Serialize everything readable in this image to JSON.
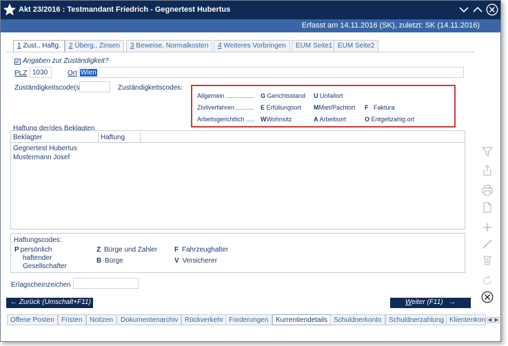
{
  "window": {
    "title": "Akt 23/2016 : Testmandant Friedrich - Gegnertest Hubertus",
    "info": "Erfasst am 14.11.2016 (SK), zuletzt: SK (14.11.2016)"
  },
  "tabs": [
    {
      "num": "1",
      "label": " Zust., Haftg."
    },
    {
      "num": "2",
      "label": " Überg., Zinsen"
    },
    {
      "num": "3",
      "label": " Beweise, Normalkosten"
    },
    {
      "num": "4",
      "label": " Weiteres Vorbringen"
    },
    {
      "num": "",
      "label": "EUM Seite1"
    },
    {
      "num": "",
      "label": "EUM Seite2"
    }
  ],
  "zustaendigkeit": {
    "checkbox_label": "Angaben zur Zuständigkeit?",
    "checked": true,
    "plz_label": "PLZ",
    "plz_value": "1030",
    "ort_label": "Ort",
    "ort_value": "Wien",
    "codes_label": "Zuständigkeitscode(s)",
    "codes_value": "",
    "codes_heading": "Zuständigkeitscodes:"
  },
  "code_table": {
    "col1": [
      "Allgemein ................",
      "Zivilverfahren ..........",
      "Arbeitsgerichtlich ....."
    ],
    "col2": [
      {
        "code": "G",
        "text": "Gerichtsstand"
      },
      {
        "code": "E",
        "text": "Erfüllungsort"
      },
      {
        "code": "W",
        "text": "Wohnsitz"
      }
    ],
    "col3": [
      {
        "code": "U",
        "text": "Unfallort"
      },
      {
        "code": "M",
        "text": "Miet/Pachtort"
      },
      {
        "code": "A",
        "text": "Arbeitsort"
      }
    ],
    "col4": [
      {
        "code": "",
        "text": ""
      },
      {
        "code": "F",
        "text": "Faktura"
      },
      {
        "code": "O",
        "text": "Entgeltzahlg.ort"
      }
    ]
  },
  "haftung": {
    "title": "Haftung der/des Beklagten",
    "columns": [
      "Beklagter",
      "Haftung"
    ],
    "rows": [
      {
        "beklagter": "Gegnertest Hubertus",
        "haftung": ""
      },
      {
        "beklagter": "Mustermann Josef",
        "haftung": ""
      }
    ]
  },
  "haftungscodes": {
    "title": "Haftungscodes:",
    "items": [
      {
        "code": "P",
        "text": "persönlich"
      },
      {
        "code": "",
        "text": "haftender"
      },
      {
        "code": "",
        "text": "Gesellschafter"
      },
      {
        "code": "Z",
        "text": "Bürge und Zahler"
      },
      {
        "code": "B",
        "text": "Bürge"
      },
      {
        "code": "F",
        "text": "Fahrzeughalter"
      },
      {
        "code": "V",
        "text": "Versicherer"
      }
    ]
  },
  "erlagschein": {
    "label": "Erlagscheinzeichen",
    "value": ""
  },
  "nav": {
    "back": "Zurück (Umschalt+F11)",
    "next_underlined": "W",
    "next": "eiter (F11)"
  },
  "bottom_tabs": [
    "Offene Posten",
    "Fristen",
    "Notizen",
    "Dokumentenarchiv",
    "Rückverkehr",
    "Forderungen",
    "Kurrentiendetails",
    "Schuldnerkonto",
    "Schuldnerzahlung",
    "Klientenkon"
  ],
  "active_bottom_tab": "Kurrentiendetails",
  "colors": {
    "titlebar": "#0f2a55",
    "infobar": "#3a66a8",
    "text": "#1f3b73",
    "highlight_border": "#cc3b3b"
  },
  "sidebar_icons": [
    "filter-icon",
    "export-icon",
    "print-icon",
    "document-icon",
    "add-icon",
    "edit-icon",
    "delete-icon",
    "refresh-icon",
    "close-circle-icon"
  ]
}
